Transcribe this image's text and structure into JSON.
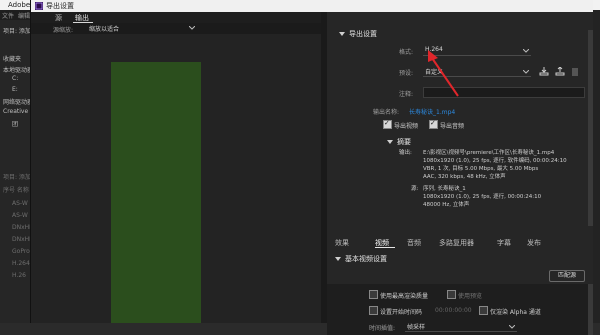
{
  "app": {
    "title": "Adobe Medi",
    "menu": [
      "文件",
      "编辑(E)"
    ],
    "left_panel": {
      "heading": "项目: 添加器",
      "items": [
        "收藏夹",
        "本地驱动器",
        "C:",
        "E:",
        "网络驱动器",
        "Creative Clo",
        "团"
      ],
      "lower_heading": "项目: 添加器",
      "lower_items": [
        "序号 名称",
        "AS-W",
        "AS-W",
        "DNxHD",
        "DNxHR",
        "GoPro",
        "H.264",
        "H.26"
      ]
    }
  },
  "dialog": {
    "title": "导出设置",
    "tabs": [
      "源",
      "输出"
    ],
    "source_scaling": {
      "label": "源缩放:",
      "value": "缩放以适合"
    }
  },
  "export_settings": {
    "heading": "导出设置",
    "format": {
      "label": "格式:",
      "value": "H.264"
    },
    "preset": {
      "label": "预设:",
      "value": "自定义"
    },
    "comments": {
      "label": "注释:"
    },
    "output_name": {
      "label": "输出名称:",
      "value": "长寿秘诀_1.mp4"
    },
    "export_video": "导出视频",
    "export_audio": "导出音频",
    "summary": {
      "heading": "摘要",
      "output_label": "输出:",
      "output_lines": [
        "E:\\影视区\\视频号\\premiere\\工作区\\长寿秘诀_1.mp4",
        "1080x1920 (1.0), 25 fps, 逐行, 软件编码, 00:00:24:10",
        "VBR, 1 次, 目标 5.00 Mbps, 最大 5.00 Mbps",
        "AAC, 320 kbps, 48 kHz, 立体声"
      ],
      "source_label": "源:",
      "source_lines": [
        "序列, 长寿秘诀_1",
        "1080x1920 (1.0), 25 fps, 逐行, 00:00:24:10",
        "48000 Hz, 立体声"
      ]
    }
  },
  "bottom_tabs": [
    "效果",
    "视频",
    "音频",
    "多路复用器",
    "字幕",
    "发布"
  ],
  "basic_video": {
    "heading": "基本视频设置",
    "match_button": "匹配源"
  },
  "bottom_options": {
    "max_render": "使用最高渲染质量",
    "use_preview": "使用预览",
    "set_start_timecode": "设置开始时间码",
    "start_timecode": "00:00:00:00",
    "render_alpha": "仅渲染 Alpha 通道",
    "time_interp": {
      "label": "时间插值:",
      "value": "帧采样"
    }
  },
  "colors": {
    "preview": "#2b4e1d",
    "link": "#2c8ae0",
    "arrow": "#e0262b"
  }
}
